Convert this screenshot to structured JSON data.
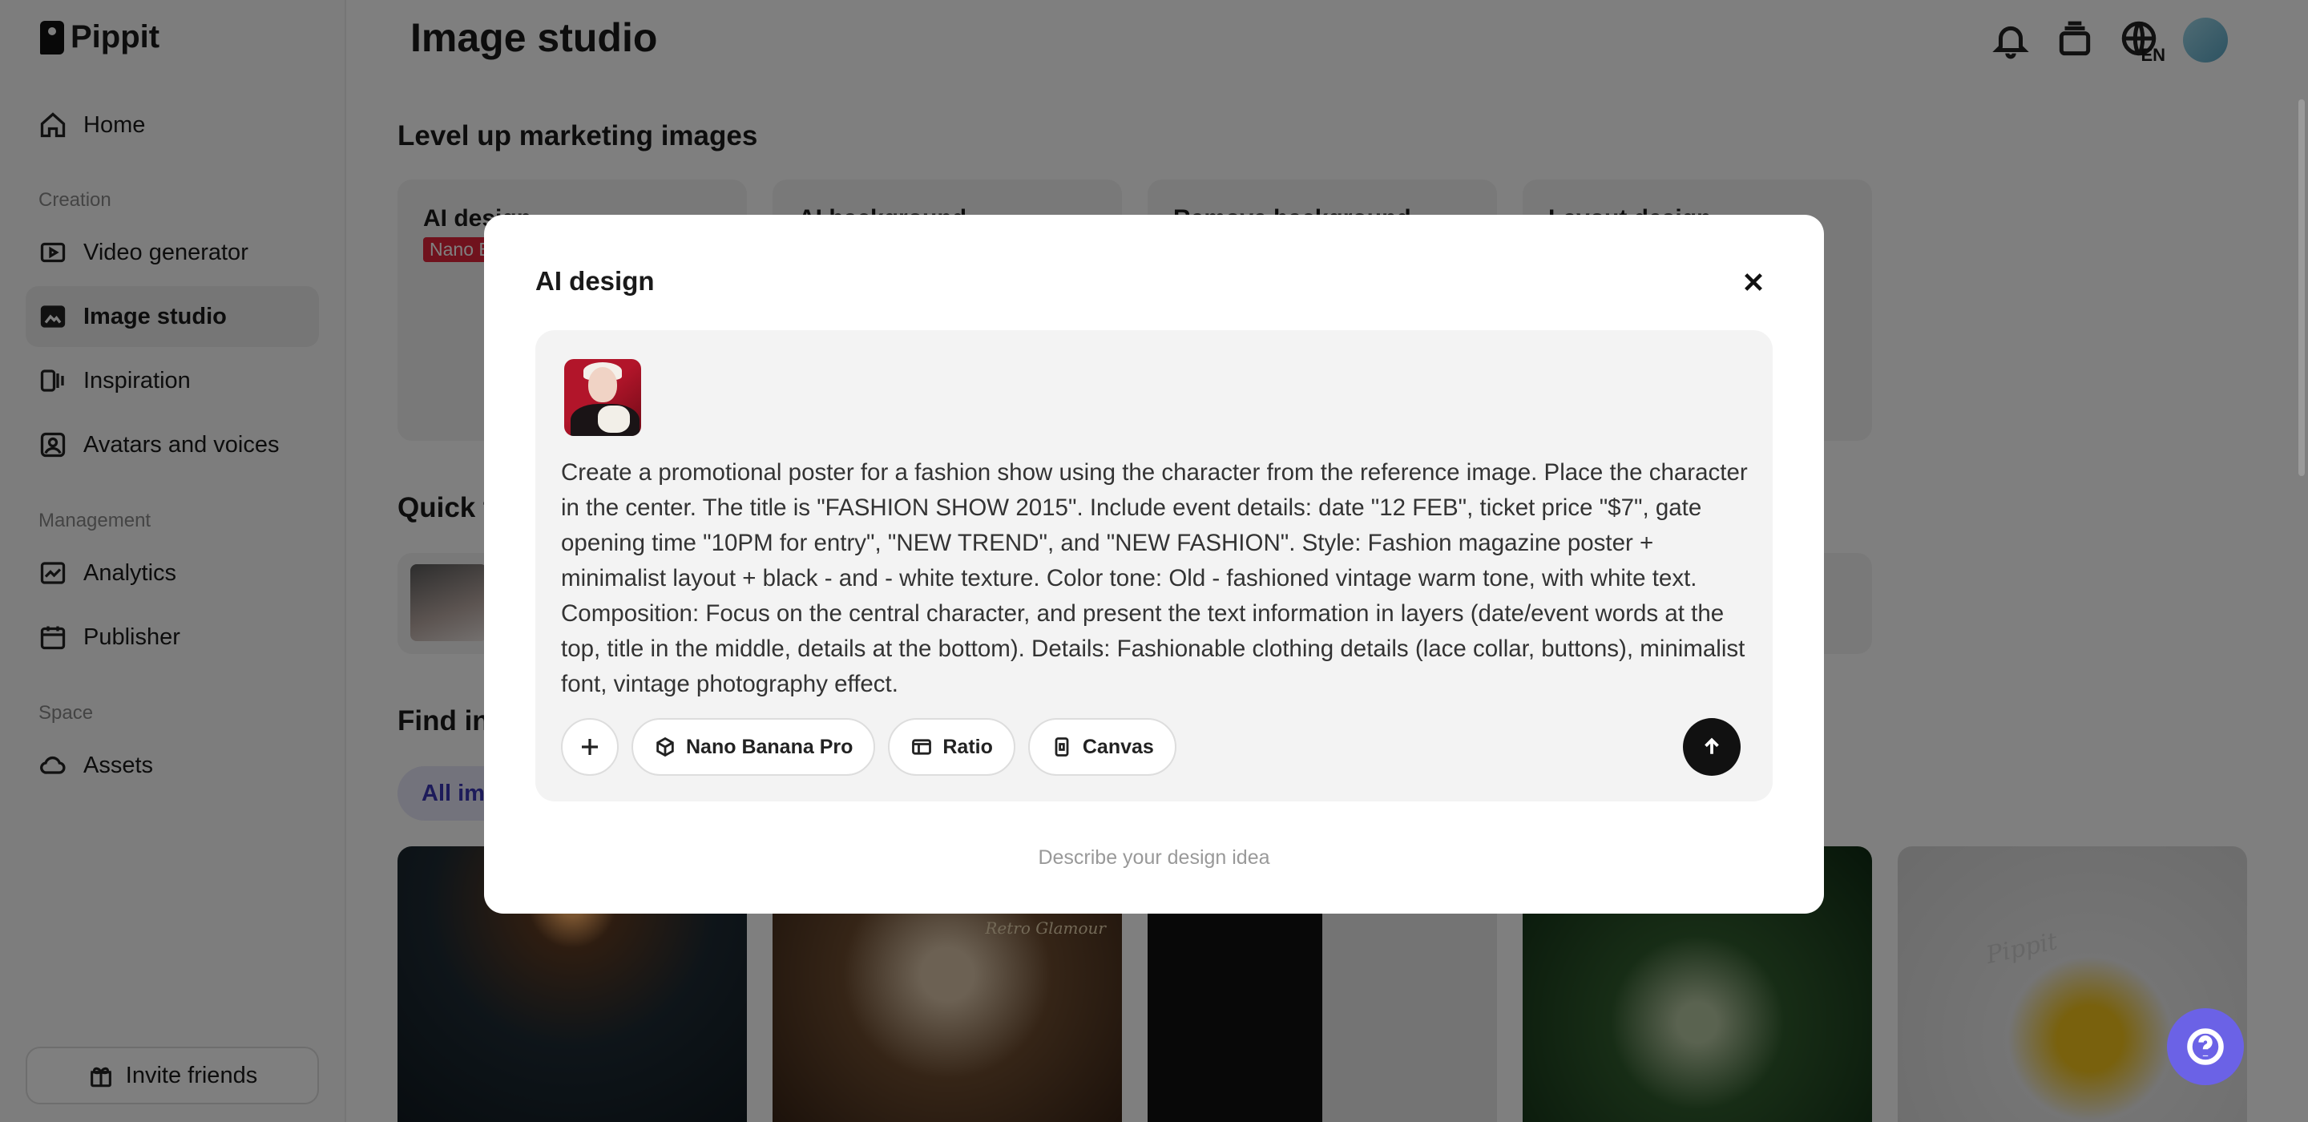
{
  "app": {
    "brand": "Pippit"
  },
  "sidebar": {
    "home": "Home",
    "creation_label": "Creation",
    "video_generator": "Video generator",
    "image_studio": "Image studio",
    "inspiration": "Inspiration",
    "avatars_voices": "Avatars and voices",
    "management_label": "Management",
    "analytics": "Analytics",
    "publisher": "Publisher",
    "space_label": "Space",
    "assets": "Assets",
    "invite": "Invite friends"
  },
  "header": {
    "title": "Image studio",
    "lang": "EN"
  },
  "main": {
    "section1": "Level up marketing images",
    "cards": [
      "AI design",
      "AI background",
      "Remove background",
      "Layout design"
    ],
    "badge": "Nano Banana Pro",
    "section2": "Quick tools",
    "section3": "Find inspiration",
    "filter_all": "All images",
    "gallery": {
      "retro": "Retro Glamour",
      "logo_text": "Pippit"
    }
  },
  "modal": {
    "title": "AI design",
    "prompt": "Create a promotional poster for a fashion show using the character from the reference image. Place the character in the center. The title is \"FASHION SHOW 2015\". Include event details: date \"12 FEB\", ticket price \"$7\", gate opening time \"10PM for entry\", \"NEW TREND\", and \"NEW FASHION\". Style: Fashion magazine poster + minimalist layout + black - and - white texture. Color tone: Old - fashioned vintage warm tone, with white text. Composition: Focus on the central character, and present the text information in layers (date/event words at the top, title in the middle, details at the bottom). Details: Fashionable clothing details (lace collar, buttons), minimalist font, vintage photography effect.",
    "model": "Nano Banana Pro",
    "ratio": "Ratio",
    "canvas": "Canvas",
    "hint": "Describe your design idea"
  },
  "colors": {
    "accent": "#6b62e6",
    "badge": "#e0243a",
    "chip": "#3b37b5"
  }
}
